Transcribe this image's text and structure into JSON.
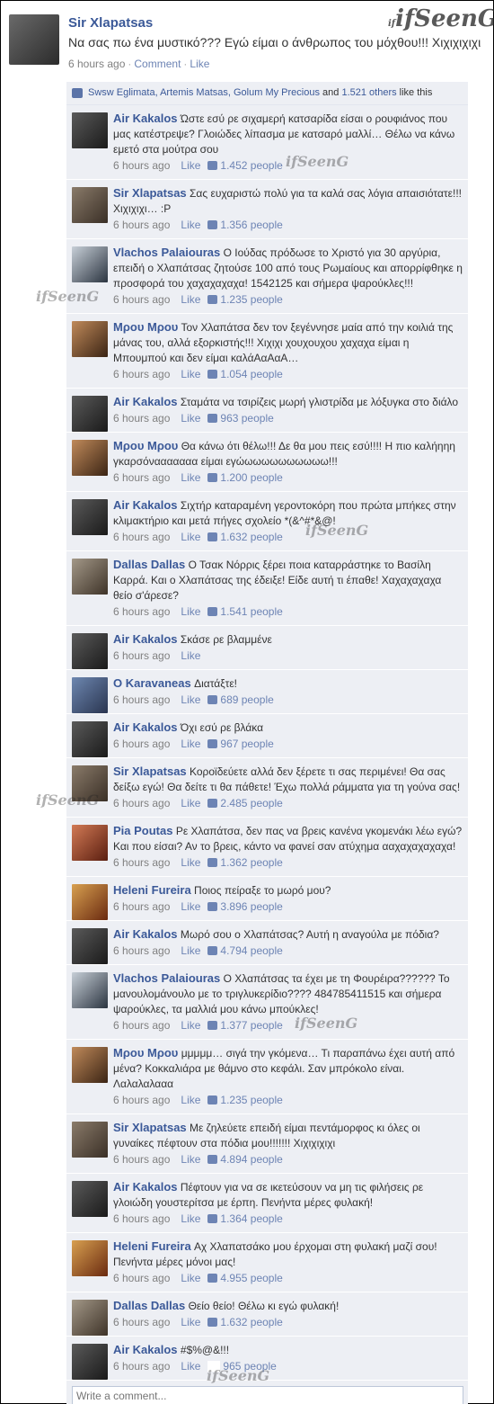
{
  "watermark": "ifSeenG",
  "post": {
    "author": "Sir Xlapatsas",
    "text": "Να σας πω ένα μυστικό??? Εγώ είμαι ο άνθρωπος του μόχθου!!! Χιχιχιχιχι",
    "time": "6 hours ago",
    "comment_label": "Comment",
    "like_label": "Like"
  },
  "likes": {
    "names": "Swsw Eglimata, Artemis Matsas, Golum My Precious",
    "and_text": "and",
    "others": "1.521 others",
    "suffix": "like this"
  },
  "comments": [
    {
      "author": "Air Kakalos",
      "avatar": "air",
      "text": "Ώστε εσύ ρε σιχαμερή κατσαρίδα είσαι ο ρουφιάνος που μας κατέστρεψε? Γλοιώδες λίπασμα με κατσαρό μαλλί… Θέλω να κάνω εμετό στα μούτρα σου",
      "time": "6 hours ago",
      "like": "Like",
      "likes": "1.452 people"
    },
    {
      "author": "Sir Xlapatsas",
      "avatar": "sir",
      "text": "Σας ευχαριστώ πολύ για τα καλά σας λόγια απαισιότατε!!! Χιχιχιχι… :P",
      "time": "6 hours ago",
      "like": "Like",
      "likes": "1.356 people"
    },
    {
      "author": "Vlachos Palaiouras",
      "avatar": "vla",
      "text": "Ο Ιούδας πρόδωσε το Χριστό για 30 αργύρια, επειδή ο Χλαπάτσας ζητούσε 100 από τους Ρωμαίους και απορρίφθηκε η προσφορά του χαχαχαχαχα! 1542125 και σήμερα ψαρούκλες!!!",
      "time": "6 hours ago",
      "like": "Like",
      "likes": "1.235 people"
    },
    {
      "author": "Μρου Μρου",
      "avatar": "mpou",
      "text": "Τον Χλαπάτσα δεν τον ξεγέννησε μαία από την κοιλιά της μάνας του, αλλά εξορκιστής!!! Χιχιχι χουχουχου χαχαχα είμαι η Μπουμπού και δεν είμαι καλάΑαΑαΑ…",
      "time": "6 hours ago",
      "like": "Like",
      "likes": "1.054 people"
    },
    {
      "author": "Air Kakalos",
      "avatar": "air",
      "text": "Σταμάτα να τσιρίζεις μωρή γλιστρίδα με λόξυγκα στο διάλο",
      "time": "6 hours ago",
      "like": "Like",
      "likes": "963 people"
    },
    {
      "author": "Μρου Μρου",
      "avatar": "mpou",
      "text": "Θα κάνω ότι θέλω!!! Δε θα μου πεις εσύ!!!! Η πιο καλήηηη γκαρσόνααααααα είμαι εγώωωωωωωωωωω!!!",
      "time": "6 hours ago",
      "like": "Like",
      "likes": "1.200 people"
    },
    {
      "author": "Air Kakalos",
      "avatar": "air",
      "text": "Σιχτήρ καταραμένη γεροντοκόρη  που πρώτα μπήκες στην κλιμακτήριο και μετά πήγες σχολείο *(&^#*&@!",
      "time": "6 hours ago",
      "like": "Like",
      "likes": "1.632 people"
    },
    {
      "author": "Dallas Dallas",
      "avatar": "dal",
      "text": "Ο Τσακ Νόρρις ξέρει ποια καταρράστηκε το Βασίλη Καρρά. Και ο Χλαπάτσας της έδειξε! Είδε αυτή τι έπαθε! Χαχαχαχαχα θείο σ'άρεσε?",
      "time": "6 hours ago",
      "like": "Like",
      "likes": "1.541 people"
    },
    {
      "author": "Air Kakalos",
      "avatar": "air",
      "text": "Σκάσε ρε βλαμμένε",
      "time": "6 hours ago",
      "like": "Like",
      "likes": ""
    },
    {
      "author": "O Karavaneas",
      "avatar": "kar",
      "text": "Διατάξτε!",
      "time": "6 hours ago",
      "like": "Like",
      "likes": "689 people"
    },
    {
      "author": "Air Kakalos",
      "avatar": "air",
      "text": "Όχι εσύ ρε βλάκα",
      "time": "6 hours ago",
      "like": "Like",
      "likes": "967 people"
    },
    {
      "author": "Sir Xlapatsas",
      "avatar": "sir",
      "text": "Κοροϊδεύετε αλλά δεν ξέρετε τι σας περιμένει! Θα σας δείξω εγώ! Θα δείτε τι θα πάθετε! Έχω πολλά ράμματα για τη γούνα σας!",
      "time": "6 hours ago",
      "like": "Like",
      "likes": "2.485 people"
    },
    {
      "author": "Pia Poutas",
      "avatar": "pia",
      "text": "Ρε Χλαπάτσα, δεν πας να βρεις κανένα γκομενάκι λέω εγώ? Και που είσαι? Αν το βρεις, κάντο να φανεί σαν ατύχημα ααχαχαχαχαχα!",
      "time": "6 hours ago",
      "like": "Like",
      "likes": "1.362 people"
    },
    {
      "author": "Heleni Fureira",
      "avatar": "hel",
      "text": "Ποιος πείραξε το μωρό μου?",
      "time": "6 hours ago",
      "like": "Like",
      "likes": "3.896 people"
    },
    {
      "author": "Air Kakalos",
      "avatar": "air",
      "text": "Μωρό σου ο Χλαπάτσας? Αυτή η αναγούλα με πόδια?",
      "time": "6 hours ago",
      "like": "Like",
      "likes": "4.794 people"
    },
    {
      "author": "Vlachos Palaiouras",
      "avatar": "vla",
      "text": "Ο Χλαπάτσας τα έχει με τη Φουρέιρα?????? Το μανουλομάνουλο με το τριγλυκερίδιο????  484785411515 και σήμερα ψαρούκλες, τα μαλλιά μου κάνω μπούκλες!",
      "time": "6 hours ago",
      "like": "Like",
      "likes": "1.377 people"
    },
    {
      "author": "Μρου Μρου",
      "avatar": "mpou",
      "text": "μμμμμ… σιγά την γκόμενα… Τι παραπάνω έχει αυτή από μένα? Κοκκαλιάρα με θάμνο στο κεφάλι. Σαν μπρόκολο είναι. Λαλαλαλααα",
      "time": "6 hours ago",
      "like": "Like",
      "likes": "1.235 people"
    },
    {
      "author": "Sir Xlapatsas",
      "avatar": "sir",
      "text": "Με ζηλεύετε επειδή είμαι πεντάμορφος κι όλες οι γυναίκες πέφτουν στα πόδια μου!!!!!!! Χιχιχιχιχι",
      "time": "6 hours ago",
      "like": "Like",
      "likes": "4.894 people"
    },
    {
      "author": "Air Kakalos",
      "avatar": "air",
      "text": "Πέφτουν για να σε ικετεύσουν να μη τις φιλήσεις ρε γλοιώδη γουστερίτσα με έρπη. Πενήντα μέρες φυλακή!",
      "time": "6 hours ago",
      "like": "Like",
      "likes": "1.364 people"
    },
    {
      "author": "Heleni Fureira",
      "avatar": "hel",
      "text": "Αχ Χλαπατσάκο μου έρχομαι στη φυλακή μαζί σου! Πενήντα μέρες μόνοι μας!",
      "time": "6 hours ago",
      "like": "Like",
      "likes": "4.955 people"
    },
    {
      "author": "Dallas Dallas",
      "avatar": "dal",
      "text": "Θείο θείο! Θέλω κι εγώ φυλακή!",
      "time": "6 hours ago",
      "like": "Like",
      "likes": "1.632 people"
    },
    {
      "author": "Air Kakalos",
      "avatar": "air",
      "text": "#$%@&!!!",
      "time": "6 hours ago",
      "like": "Like",
      "likes": "965 people"
    }
  ],
  "write_comment": {
    "placeholder": "Write a comment..."
  }
}
